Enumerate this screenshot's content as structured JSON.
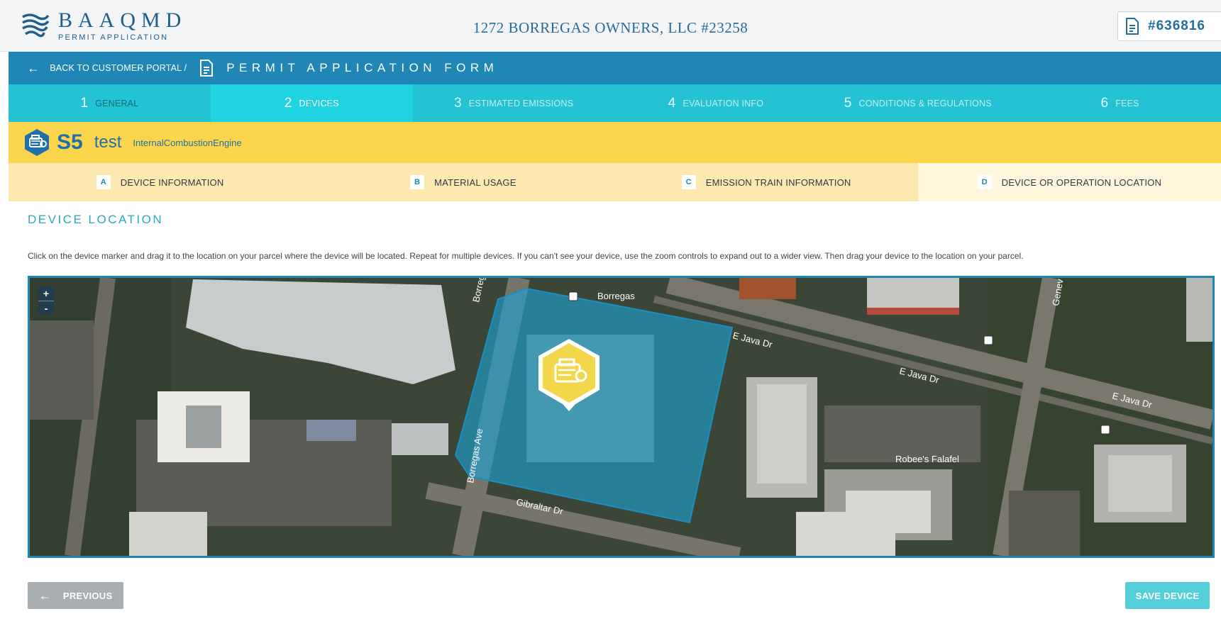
{
  "header": {
    "logo_name": "BAAQMD",
    "logo_sub": "PERMIT APPLICATION",
    "title": "1272 BORREGAS OWNERS, LLC #23258",
    "app_number": "#636816"
  },
  "nav": {
    "back_label": "BACK TO CUSTOMER PORTAL /",
    "form_title": "PERMIT APPLICATION FORM"
  },
  "steps": [
    {
      "num": "1",
      "label": "GENERAL"
    },
    {
      "num": "2",
      "label": "DEVICES"
    },
    {
      "num": "3",
      "label": "ESTIMATED EMISSIONS"
    },
    {
      "num": "4",
      "label": "EVALUATION INFO"
    },
    {
      "num": "5",
      "label": "CONDITIONS & REGULATIONS"
    },
    {
      "num": "6",
      "label": "FEES"
    }
  ],
  "device": {
    "id": "S5",
    "name": "test",
    "type": "InternalCombustionEngine"
  },
  "subtabs": [
    {
      "letter": "A",
      "label": "DEVICE INFORMATION"
    },
    {
      "letter": "B",
      "label": "MATERIAL USAGE"
    },
    {
      "letter": "C",
      "label": "EMISSION TRAIN INFORMATION"
    },
    {
      "letter": "D",
      "label": "DEVICE OR OPERATION LOCATION"
    }
  ],
  "content": {
    "section_title": "DEVICE LOCATION",
    "instructions": "Click on the device marker and drag it to the location on your parcel where the device will be located. Repeat for multiple devices. If you can't see your device, use the zoom controls to expand out to a wider view. Then drag your device to the location on your parcel."
  },
  "map": {
    "zoom_in": "+",
    "zoom_out": "-",
    "streets": {
      "borregas_top": "Borreg",
      "borregas_station": "Borregas",
      "e_java_1": "E Java Dr",
      "e_java_2": "E Java Dr",
      "e_java_3": "E Java Dr",
      "borregas_ave": "Borregas Ave",
      "gibraltar": "Gibraltar Dr",
      "geneva": "Genev",
      "robees": "Robee's Falafel"
    }
  },
  "buttons": {
    "previous": "PREVIOUS",
    "save": "SAVE DEVICE"
  },
  "colors": {
    "primary_blue": "#1f86b5",
    "step_teal": "#23c3d3",
    "device_yellow": "#fbd54c",
    "subtab_cream": "#fde9b0",
    "parcel_overlay": "#1aa4d8",
    "marker_yellow": "#f3d64a"
  }
}
